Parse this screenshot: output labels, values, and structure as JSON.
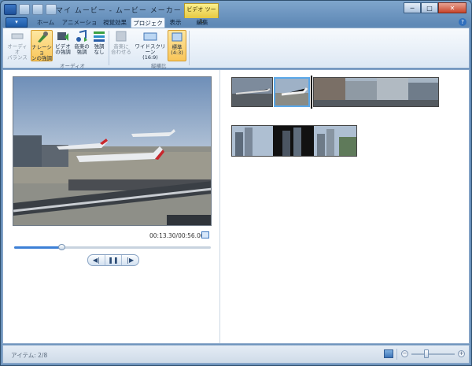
{
  "window": {
    "title": "マイ ムービー - ムービー メーカー",
    "context_tab_header": "ビデオ ツール",
    "minimize": "─",
    "maximize": "□",
    "close": "✕"
  },
  "ribbon": {
    "file_button": "▾",
    "tabs": [
      {
        "label": "ホーム"
      },
      {
        "label": "アニメーション"
      },
      {
        "label": "視覚効果"
      },
      {
        "label": "プロジェクト",
        "active": true
      },
      {
        "label": "表示"
      },
      {
        "label": "編集"
      }
    ],
    "help": "?",
    "buttons": {
      "audio_balance": "オーディオ\nバランス",
      "narration_emphasis": "ナレーショ\nンの強調",
      "video_emphasis": "ビデオ\nの強調",
      "music_emphasis": "音楽の\n強調",
      "no_emphasis": "強調\nなし",
      "fit_to_music": "音楽に\n合わせる",
      "widescreen": "ワイドスクリーン\n(16:9)",
      "standard": "標準\n(4:3)"
    },
    "groups": {
      "audio": "オーディオ",
      "aspect_ratio": "縦横比"
    }
  },
  "player": {
    "timecode": "00:13.30/00:56.00",
    "progress": 0.24,
    "controls": {
      "previous": "◀|",
      "play_pause": "❚❚",
      "next": "|▶"
    }
  },
  "status": {
    "items": "アイテム: 2/8",
    "zoom_out": "−",
    "zoom_in": "+",
    "zoom_level": 0.3
  },
  "colors": {
    "accent": "#3d80d6",
    "selected_button": "#f9c65a",
    "context_tab": "#e6c943"
  }
}
